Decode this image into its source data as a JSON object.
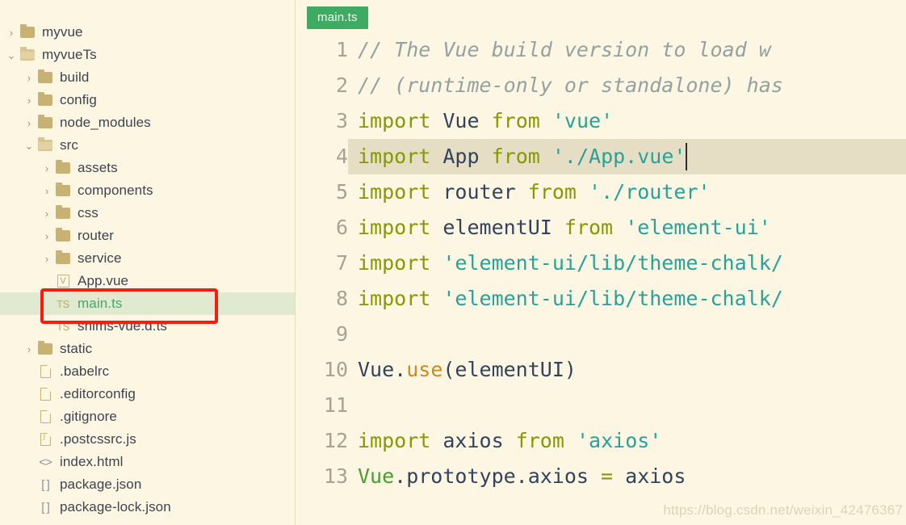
{
  "colors": {
    "background": "#fdf6e3",
    "tab_green": "#3faa62",
    "selection_green": "#dfead0",
    "highlight_box_red": "#fc1b0f",
    "active_line": "#e6dec4",
    "keyword": "#859900",
    "string": "#2aa198",
    "comment": "#93a1a1",
    "identifier": "#33435c",
    "function": "#cb8b1a",
    "folder_icon": "#c8b273",
    "line_number": "#a6a390"
  },
  "sidebar": {
    "items": [
      {
        "label": "myvue",
        "indent": 0,
        "twisty": "collapsed",
        "icon": "folder-icon",
        "selected": false
      },
      {
        "label": "myvueTs",
        "indent": 0,
        "twisty": "expanded",
        "icon": "folder-open-icon",
        "selected": false
      },
      {
        "label": "build",
        "indent": 1,
        "twisty": "collapsed",
        "icon": "folder-icon",
        "selected": false
      },
      {
        "label": "config",
        "indent": 1,
        "twisty": "collapsed",
        "icon": "folder-icon",
        "selected": false
      },
      {
        "label": "node_modules",
        "indent": 1,
        "twisty": "collapsed",
        "icon": "folder-icon",
        "selected": false
      },
      {
        "label": "src",
        "indent": 1,
        "twisty": "expanded",
        "icon": "folder-open-icon",
        "selected": false
      },
      {
        "label": "assets",
        "indent": 2,
        "twisty": "collapsed",
        "icon": "folder-icon",
        "selected": false
      },
      {
        "label": "components",
        "indent": 2,
        "twisty": "collapsed",
        "icon": "folder-icon",
        "selected": false
      },
      {
        "label": "css",
        "indent": 2,
        "twisty": "collapsed",
        "icon": "folder-icon",
        "selected": false
      },
      {
        "label": "router",
        "indent": 2,
        "twisty": "collapsed",
        "icon": "folder-icon",
        "selected": false
      },
      {
        "label": "service",
        "indent": 2,
        "twisty": "collapsed",
        "icon": "folder-icon",
        "selected": false
      },
      {
        "label": "App.vue",
        "indent": 2,
        "twisty": "none",
        "icon": "vue-file-icon",
        "selected": false
      },
      {
        "label": "main.ts",
        "indent": 2,
        "twisty": "none",
        "icon": "ts-file-icon",
        "selected": true
      },
      {
        "label": "shims-vue.d.ts",
        "indent": 2,
        "twisty": "none",
        "icon": "ts-file-icon",
        "selected": false
      },
      {
        "label": "static",
        "indent": 1,
        "twisty": "collapsed",
        "icon": "folder-icon",
        "selected": false
      },
      {
        "label": ".babelrc",
        "indent": 1,
        "twisty": "none",
        "icon": "file-icon",
        "selected": false
      },
      {
        "label": ".editorconfig",
        "indent": 1,
        "twisty": "none",
        "icon": "file-icon",
        "selected": false
      },
      {
        "label": ".gitignore",
        "indent": 1,
        "twisty": "none",
        "icon": "file-icon",
        "selected": false
      },
      {
        "label": ".postcssrc.js",
        "indent": 1,
        "twisty": "none",
        "icon": "js-file-icon",
        "selected": false
      },
      {
        "label": "index.html",
        "indent": 1,
        "twisty": "none",
        "icon": "html-file-icon",
        "selected": false
      },
      {
        "label": "package.json",
        "indent": 1,
        "twisty": "none",
        "icon": "json-file-icon",
        "selected": false
      },
      {
        "label": "package-lock.json",
        "indent": 1,
        "twisty": "none",
        "icon": "json-file-icon",
        "selected": false
      }
    ],
    "icon_glyphs": {
      "html-file-icon": "<>",
      "json-file-icon": "[ ]",
      "ts-file-icon": "TS",
      "vue-file-icon": "V"
    },
    "twisty_glyphs": {
      "collapsed": "›",
      "expanded": "⌄"
    }
  },
  "editor": {
    "tab": {
      "label": "main.ts",
      "active": true
    },
    "active_line": 4,
    "caret_line": 4,
    "lines": [
      {
        "num": "1",
        "tokens": [
          {
            "t": "// The Vue build version to load w",
            "c": "comment"
          }
        ]
      },
      {
        "num": "2",
        "tokens": [
          {
            "t": "// (runtime-only or standalone) has",
            "c": "comment"
          }
        ]
      },
      {
        "num": "3",
        "tokens": [
          {
            "t": "import",
            "c": "kw"
          },
          {
            "t": " ",
            "c": "plain"
          },
          {
            "t": "Vue",
            "c": "id"
          },
          {
            "t": " ",
            "c": "plain"
          },
          {
            "t": "from",
            "c": "kw"
          },
          {
            "t": " ",
            "c": "plain"
          },
          {
            "t": "'vue'",
            "c": "str"
          }
        ]
      },
      {
        "num": "4",
        "tokens": [
          {
            "t": "import",
            "c": "kw"
          },
          {
            "t": " ",
            "c": "plain"
          },
          {
            "t": "App",
            "c": "id"
          },
          {
            "t": " ",
            "c": "plain"
          },
          {
            "t": "from",
            "c": "kw"
          },
          {
            "t": " ",
            "c": "plain"
          },
          {
            "t": "'./App.vue'",
            "c": "str"
          }
        ]
      },
      {
        "num": "5",
        "tokens": [
          {
            "t": "import",
            "c": "kw"
          },
          {
            "t": " ",
            "c": "plain"
          },
          {
            "t": "router",
            "c": "id"
          },
          {
            "t": " ",
            "c": "plain"
          },
          {
            "t": "from",
            "c": "kw"
          },
          {
            "t": " ",
            "c": "plain"
          },
          {
            "t": "'./router'",
            "c": "str"
          }
        ]
      },
      {
        "num": "6",
        "tokens": [
          {
            "t": "import",
            "c": "kw"
          },
          {
            "t": " ",
            "c": "plain"
          },
          {
            "t": "elementUI",
            "c": "id"
          },
          {
            "t": " ",
            "c": "plain"
          },
          {
            "t": "from",
            "c": "kw"
          },
          {
            "t": " ",
            "c": "plain"
          },
          {
            "t": "'element-ui'",
            "c": "str"
          }
        ]
      },
      {
        "num": "7",
        "tokens": [
          {
            "t": "import",
            "c": "kw"
          },
          {
            "t": " ",
            "c": "plain"
          },
          {
            "t": "'element-ui/lib/theme-chalk/",
            "c": "str"
          }
        ]
      },
      {
        "num": "8",
        "tokens": [
          {
            "t": "import",
            "c": "kw"
          },
          {
            "t": " ",
            "c": "plain"
          },
          {
            "t": "'element-ui/lib/theme-chalk/",
            "c": "str"
          }
        ]
      },
      {
        "num": "9",
        "tokens": []
      },
      {
        "num": "10",
        "tokens": [
          {
            "t": "Vue",
            "c": "id"
          },
          {
            "t": ".",
            "c": "plain"
          },
          {
            "t": "use",
            "c": "fn"
          },
          {
            "t": "(elementUI)",
            "c": "plain"
          }
        ]
      },
      {
        "num": "11",
        "tokens": []
      },
      {
        "num": "12",
        "tokens": [
          {
            "t": "import",
            "c": "kw"
          },
          {
            "t": " ",
            "c": "plain"
          },
          {
            "t": "axios",
            "c": "id"
          },
          {
            "t": " ",
            "c": "plain"
          },
          {
            "t": "from",
            "c": "kw"
          },
          {
            "t": " ",
            "c": "plain"
          },
          {
            "t": "'axios'",
            "c": "str"
          }
        ]
      },
      {
        "num": "13",
        "tokens": [
          {
            "t": "Vue",
            "c": "green"
          },
          {
            "t": ".prototype.axios ",
            "c": "plain"
          },
          {
            "t": "=",
            "c": "op"
          },
          {
            "t": " axios",
            "c": "plain"
          }
        ]
      }
    ]
  },
  "watermark": {
    "text": "https://blog.csdn.net/weixin_42476367"
  }
}
